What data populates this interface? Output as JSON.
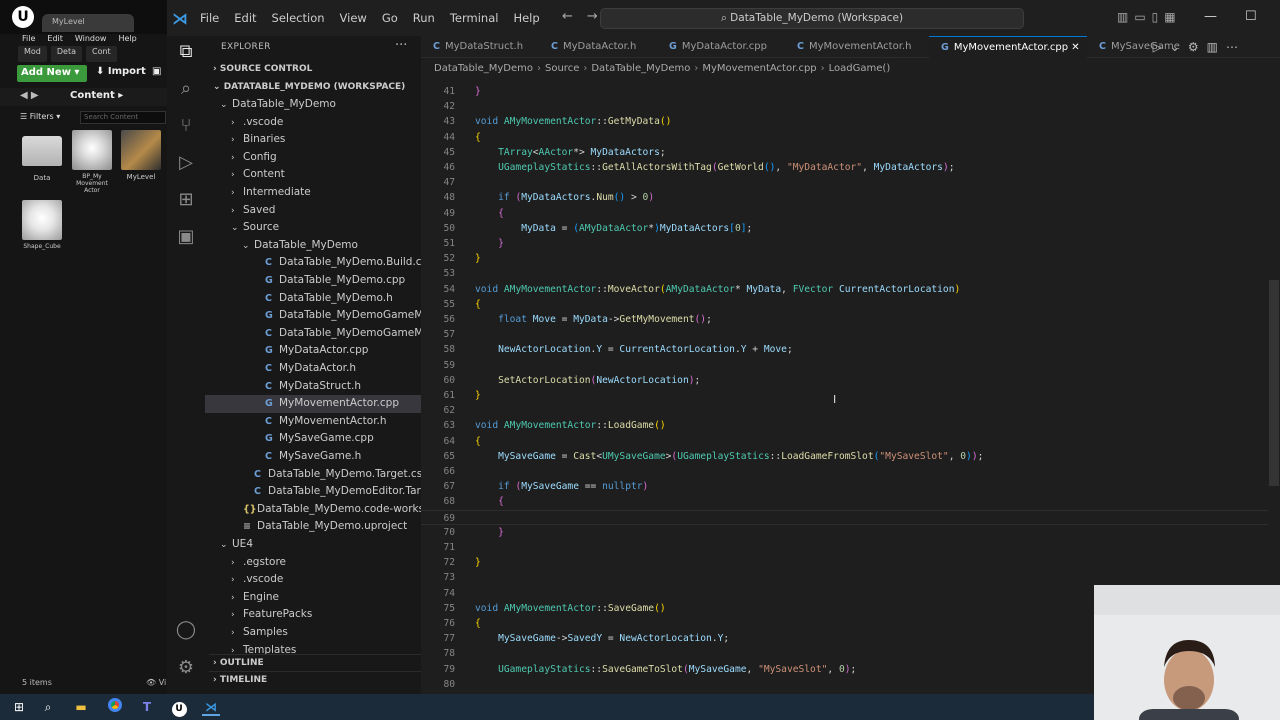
{
  "unreal": {
    "tab_title": "MyLevel",
    "menu": [
      "File",
      "Edit",
      "Window",
      "Help"
    ],
    "subtabs": [
      "Mod",
      "Deta",
      "Cont"
    ],
    "add_new_label": "Add New",
    "import_label": "Import",
    "breadcrumb": "Content",
    "filters_label": "Filters",
    "search_placeholder": "Search Content",
    "assets": [
      {
        "label": "Data",
        "icon": "folder-icon"
      },
      {
        "label": "BP_My Movement Actor",
        "icon": "blueprint-cube-icon"
      },
      {
        "label": "MyLevel",
        "icon": "level-icon"
      },
      {
        "label": "Shape_Cube",
        "icon": "cube-icon"
      }
    ],
    "items_count": "5 items",
    "view_label": "Vi"
  },
  "vscode": {
    "menu": [
      "File",
      "Edit",
      "Selection",
      "View",
      "Go",
      "Run",
      "Terminal",
      "Help"
    ],
    "command_center": "DataTable_MyDemo (Workspace)",
    "explorer_title": "EXPLORER",
    "source_control": "SOURCE CONTROL",
    "workspace_title": "DATATABLE_MYDEMO (WORKSPACE)",
    "outline": "OUTLINE",
    "timeline": "TIMELINE",
    "tree": [
      {
        "label": "DataTable_MyDemo",
        "depth": 1,
        "chev": "⌄",
        "icon": ""
      },
      {
        "label": ".vscode",
        "depth": 2,
        "chev": "›",
        "icon": ""
      },
      {
        "label": "Binaries",
        "depth": 2,
        "chev": "›",
        "icon": ""
      },
      {
        "label": "Config",
        "depth": 2,
        "chev": "›",
        "icon": ""
      },
      {
        "label": "Content",
        "depth": 2,
        "chev": "›",
        "icon": ""
      },
      {
        "label": "Intermediate",
        "depth": 2,
        "chev": "›",
        "icon": ""
      },
      {
        "label": "Saved",
        "depth": 2,
        "chev": "›",
        "icon": ""
      },
      {
        "label": "Source",
        "depth": 2,
        "chev": "⌄",
        "icon": ""
      },
      {
        "label": "DataTable_MyDemo",
        "depth": 3,
        "chev": "⌄",
        "icon": ""
      },
      {
        "label": "DataTable_MyDemo.Build.cs",
        "depth": 4,
        "chev": "",
        "icon": "C#"
      },
      {
        "label": "DataTable_MyDemo.cpp",
        "depth": 4,
        "chev": "",
        "icon": "C+"
      },
      {
        "label": "DataTable_MyDemo.h",
        "depth": 4,
        "chev": "",
        "icon": "C"
      },
      {
        "label": "DataTable_MyDemoGameModeBas...",
        "depth": 4,
        "chev": "",
        "icon": "C+"
      },
      {
        "label": "DataTable_MyDemoGameModeBas...",
        "depth": 4,
        "chev": "",
        "icon": "C"
      },
      {
        "label": "MyDataActor.cpp",
        "depth": 4,
        "chev": "",
        "icon": "C+"
      },
      {
        "label": "MyDataActor.h",
        "depth": 4,
        "chev": "",
        "icon": "C"
      },
      {
        "label": "MyDataStruct.h",
        "depth": 4,
        "chev": "",
        "icon": "C"
      },
      {
        "label": "MyMovementActor.cpp",
        "depth": 4,
        "chev": "",
        "icon": "C+",
        "selected": true
      },
      {
        "label": "MyMovementActor.h",
        "depth": 4,
        "chev": "",
        "icon": "C"
      },
      {
        "label": "MySaveGame.cpp",
        "depth": 4,
        "chev": "",
        "icon": "C+"
      },
      {
        "label": "MySaveGame.h",
        "depth": 4,
        "chev": "",
        "icon": "C"
      },
      {
        "label": "DataTable_MyDemo.Target.cs",
        "depth": 3,
        "chev": "",
        "icon": "C#"
      },
      {
        "label": "DataTable_MyDemoEditor.Target.cs",
        "depth": 3,
        "chev": "",
        "icon": "C#"
      },
      {
        "label": "DataTable_MyDemo.code-workspace",
        "depth": 2,
        "chev": "",
        "icon": "{}"
      },
      {
        "label": "DataTable_MyDemo.uproject",
        "depth": 2,
        "chev": "",
        "icon": "≡"
      },
      {
        "label": "UE4",
        "depth": 1,
        "chev": "⌄",
        "icon": ""
      },
      {
        "label": ".egstore",
        "depth": 2,
        "chev": "›",
        "icon": ""
      },
      {
        "label": ".vscode",
        "depth": 2,
        "chev": "›",
        "icon": ""
      },
      {
        "label": "Engine",
        "depth": 2,
        "chev": "›",
        "icon": ""
      },
      {
        "label": "FeaturePacks",
        "depth": 2,
        "chev": "›",
        "icon": ""
      },
      {
        "label": "Samples",
        "depth": 2,
        "chev": "›",
        "icon": ""
      },
      {
        "label": "Templates",
        "depth": 2,
        "chev": "›",
        "icon": ""
      }
    ],
    "tabs": [
      {
        "label": "MyDataStruct.h",
        "icon": "C"
      },
      {
        "label": "MyDataActor.h",
        "icon": "C"
      },
      {
        "label": "MyDataActor.cpp",
        "icon": "C+"
      },
      {
        "label": "MyMovementActor.h",
        "icon": "C"
      },
      {
        "label": "MyMovementActor.cpp",
        "icon": "C+",
        "active": true
      },
      {
        "label": "MySaveGame",
        "icon": "C"
      }
    ],
    "breadcrumb": [
      "DataTable_MyDemo",
      "Source",
      "DataTable_MyDemo",
      "MyMovementActor.cpp",
      "LoadGame()"
    ],
    "first_line": 41,
    "current_line": 69,
    "code": [
      [
        [
          "b2",
          "}"
        ]
      ],
      [],
      [
        [
          "k",
          "void "
        ],
        [
          "t",
          "AMyMovementActor"
        ],
        [
          "",
          "::"
        ],
        [
          "f",
          "GetMyData"
        ],
        [
          "b1",
          "()"
        ]
      ],
      [
        [
          "b1",
          "{"
        ]
      ],
      [
        [
          "",
          "    "
        ],
        [
          "t",
          "TArray"
        ],
        [
          "",
          "<"
        ],
        [
          "t",
          "AActor"
        ],
        [
          "",
          "*> "
        ],
        [
          "v",
          "MyDataActors"
        ],
        [
          "",
          ";"
        ]
      ],
      [
        [
          "",
          "    "
        ],
        [
          "t",
          "UGameplayStatics"
        ],
        [
          "",
          "::"
        ],
        [
          "f",
          "GetAllActorsWithTag"
        ],
        [
          "b2",
          "("
        ],
        [
          "f",
          "GetWorld"
        ],
        [
          "b3",
          "()"
        ],
        [
          "",
          ", "
        ],
        [
          "s",
          "\"MyDataActor\""
        ],
        [
          "",
          ", "
        ],
        [
          "v",
          "MyDataActors"
        ],
        [
          "b2",
          ")"
        ],
        [
          "",
          ";"
        ]
      ],
      [],
      [
        [
          "",
          "    "
        ],
        [
          "k",
          "if "
        ],
        [
          "b2",
          "("
        ],
        [
          "v",
          "MyDataActors"
        ],
        [
          "",
          "."
        ],
        [
          "f",
          "Num"
        ],
        [
          "b3",
          "()"
        ],
        [
          "",
          " > "
        ],
        [
          "n",
          "0"
        ],
        [
          "b2",
          ")"
        ]
      ],
      [
        [
          "",
          "    "
        ],
        [
          "b2",
          "{"
        ]
      ],
      [
        [
          "",
          "        "
        ],
        [
          "v",
          "MyData"
        ],
        [
          "",
          " = "
        ],
        [
          "b3",
          "("
        ],
        [
          "t",
          "AMyDataActor"
        ],
        [
          "",
          "*"
        ],
        [
          "b3",
          ")"
        ],
        [
          "v",
          "MyDataActors"
        ],
        [
          "b3",
          "["
        ],
        [
          "n",
          "0"
        ],
        [
          "b3",
          "]"
        ],
        [
          "",
          ";"
        ]
      ],
      [
        [
          "",
          "    "
        ],
        [
          "b2",
          "}"
        ]
      ],
      [
        [
          "b1",
          "}"
        ]
      ],
      [],
      [
        [
          "k",
          "void "
        ],
        [
          "t",
          "AMyMovementActor"
        ],
        [
          "",
          "::"
        ],
        [
          "f",
          "MoveActor"
        ],
        [
          "b1",
          "("
        ],
        [
          "t",
          "AMyDataActor"
        ],
        [
          "",
          "* "
        ],
        [
          "v",
          "MyData"
        ],
        [
          "",
          ", "
        ],
        [
          "t",
          "FVector "
        ],
        [
          "v",
          "CurrentActorLocation"
        ],
        [
          "b1",
          ")"
        ]
      ],
      [
        [
          "b1",
          "{"
        ]
      ],
      [
        [
          "",
          "    "
        ],
        [
          "k",
          "float "
        ],
        [
          "v",
          "Move"
        ],
        [
          "",
          " = "
        ],
        [
          "v",
          "MyData"
        ],
        [
          "",
          "->"
        ],
        [
          "f",
          "GetMyMovement"
        ],
        [
          "b2",
          "()"
        ],
        [
          "",
          ";"
        ]
      ],
      [],
      [
        [
          "",
          "    "
        ],
        [
          "v",
          "NewActorLocation"
        ],
        [
          "",
          "."
        ],
        [
          "v",
          "Y"
        ],
        [
          "",
          " = "
        ],
        [
          "v",
          "CurrentActorLocation"
        ],
        [
          "",
          "."
        ],
        [
          "v",
          "Y"
        ],
        [
          "",
          " + "
        ],
        [
          "v",
          "Move"
        ],
        [
          "",
          ";"
        ]
      ],
      [],
      [
        [
          "",
          "    "
        ],
        [
          "f",
          "SetActorLocation"
        ],
        [
          "b2",
          "("
        ],
        [
          "v",
          "NewActorLocation"
        ],
        [
          "b2",
          ")"
        ],
        [
          "",
          ";"
        ]
      ],
      [
        [
          "b1",
          "}"
        ]
      ],
      [],
      [
        [
          "k",
          "void "
        ],
        [
          "t",
          "AMyMovementActor"
        ],
        [
          "",
          "::"
        ],
        [
          "f",
          "LoadGame"
        ],
        [
          "b1",
          "()"
        ]
      ],
      [
        [
          "b1",
          "{"
        ]
      ],
      [
        [
          "",
          "    "
        ],
        [
          "v",
          "MySaveGame"
        ],
        [
          "",
          " = "
        ],
        [
          "f",
          "Cast"
        ],
        [
          "",
          "<"
        ],
        [
          "t",
          "UMySaveGame"
        ],
        [
          "",
          ">"
        ],
        [
          "b2",
          "("
        ],
        [
          "t",
          "UGameplayStatics"
        ],
        [
          "",
          "::"
        ],
        [
          "f",
          "LoadGameFromSlot"
        ],
        [
          "b3",
          "("
        ],
        [
          "s",
          "\"MySaveSlot\""
        ],
        [
          "",
          ", "
        ],
        [
          "n",
          "0"
        ],
        [
          "b3",
          ")"
        ],
        [
          "b2",
          ")"
        ],
        [
          "",
          ";"
        ]
      ],
      [],
      [
        [
          "",
          "    "
        ],
        [
          "k",
          "if "
        ],
        [
          "b2",
          "("
        ],
        [
          "v",
          "MySaveGame"
        ],
        [
          "",
          " == "
        ],
        [
          "k",
          "nullptr"
        ],
        [
          "b2",
          ")"
        ]
      ],
      [
        [
          "",
          "    "
        ],
        [
          "b2",
          "{"
        ]
      ],
      [],
      [
        [
          "",
          "    "
        ],
        [
          "b2",
          "}"
        ]
      ],
      [],
      [
        [
          "b1",
          "}"
        ]
      ],
      [],
      [],
      [
        [
          "k",
          "void "
        ],
        [
          "t",
          "AMyMovementActor"
        ],
        [
          "",
          "::"
        ],
        [
          "f",
          "SaveGame"
        ],
        [
          "b1",
          "()"
        ]
      ],
      [
        [
          "b1",
          "{"
        ]
      ],
      [
        [
          "",
          "    "
        ],
        [
          "v",
          "MySaveGame"
        ],
        [
          "",
          "->"
        ],
        [
          "v",
          "SavedY"
        ],
        [
          "",
          " = "
        ],
        [
          "v",
          "NewActorLocation"
        ],
        [
          "",
          "."
        ],
        [
          "v",
          "Y"
        ],
        [
          "",
          ";"
        ]
      ],
      [],
      [
        [
          "",
          "    "
        ],
        [
          "t",
          "UGameplayStatics"
        ],
        [
          "",
          "::"
        ],
        [
          "f",
          "SaveGameToSlot"
        ],
        [
          "b2",
          "("
        ],
        [
          "v",
          "MySaveGame"
        ],
        [
          "",
          ", "
        ],
        [
          "s",
          "\"MySaveSlot\""
        ],
        [
          "",
          ", "
        ],
        [
          "n",
          "0"
        ],
        [
          "b2",
          ")"
        ],
        [
          "",
          ";"
        ]
      ],
      []
    ]
  },
  "taskbar": {
    "icons": [
      "windows-start-icon",
      "search-icon",
      "file-explorer-icon",
      "chrome-icon",
      "teams-icon",
      "unreal-icon",
      "vscode-icon"
    ]
  },
  "colors": {
    "accent": "#0078d4",
    "add_new_green": "#3b9a3b",
    "taskbar": "#1c2b3a"
  }
}
